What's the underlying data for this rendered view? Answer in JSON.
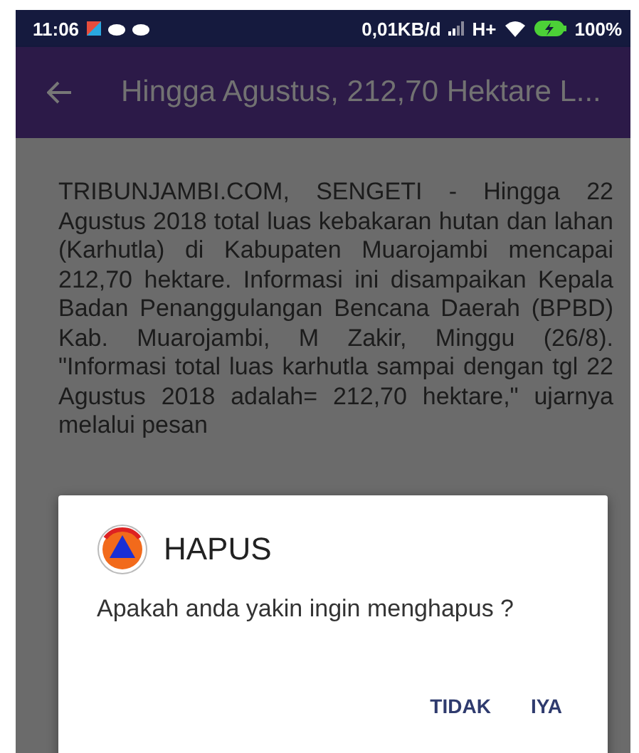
{
  "status_bar": {
    "time": "11:06",
    "network_speed": "0,01KB/d",
    "network_type": "H+",
    "battery": "100%"
  },
  "app_bar": {
    "title": "Hingga Agustus, 212,70 Hektare L..."
  },
  "article": {
    "text": "TRIBUNJAMBI.COM, SENGETI - Hingga 22 Agustus 2018 total luas kebakaran hutan dan lahan (Karhutla) di Kabupaten Muarojambi mencapai 212,70 hektare. Informasi ini disampaikan Kepala Badan Penanggulangan Bencana Daerah (BPBD) Kab. Muarojambi, M Zakir, Minggu (26/8). \"Informasi total luas karhutla sampai dengan tgl 22 Agustus 2018 adalah= 212,70 hektare,\" ujarnya melalui pesan"
  },
  "dialog": {
    "title": "HAPUS",
    "message": "Apakah anda yakin ingin menghapus ?",
    "buttons": [
      "TIDAK",
      "IYA"
    ]
  }
}
